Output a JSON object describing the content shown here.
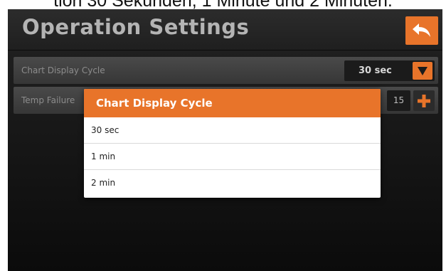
{
  "caption": "tion 30 Sekunden, 1 Minute und 2 Minuten.",
  "header": {
    "title": "Operation Settings",
    "back_icon": "back-arrow-icon"
  },
  "settings": [
    {
      "label": "Chart Display Cycle",
      "value": "30 sec"
    },
    {
      "label": "Temp Failure",
      "value": "15"
    }
  ],
  "popup": {
    "title": "Chart Display Cycle",
    "options": [
      "30 sec",
      "1 min",
      "2 min"
    ]
  },
  "colors": {
    "accent": "#e8742a",
    "background": "#161616",
    "row": "#404040"
  }
}
